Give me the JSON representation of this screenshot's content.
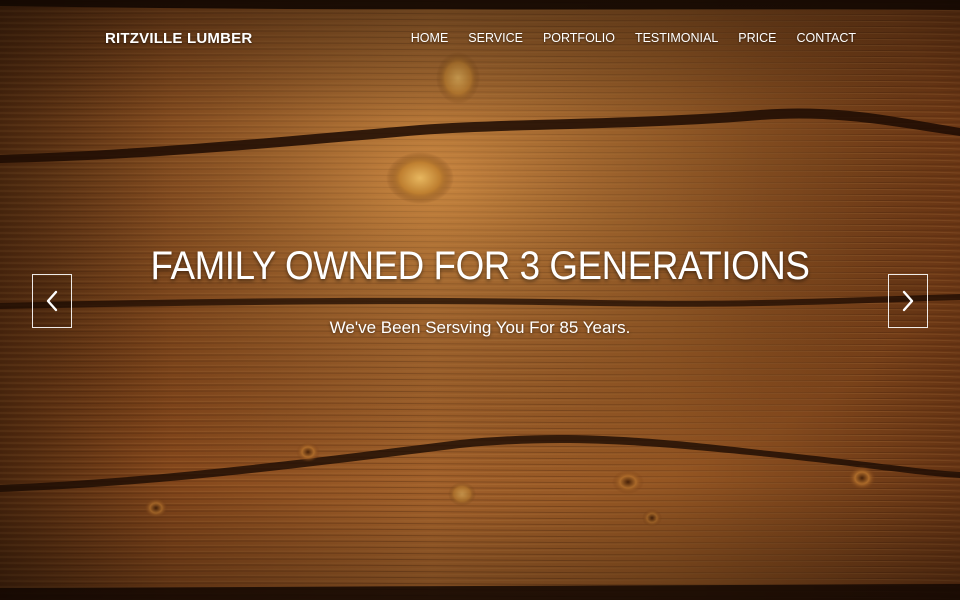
{
  "brand": {
    "name": "RITZVILLE LUMBER"
  },
  "nav": {
    "items": [
      {
        "label": "HOME"
      },
      {
        "label": "SERVICE"
      },
      {
        "label": "PORTFOLIO"
      },
      {
        "label": "TESTIMONIAL"
      },
      {
        "label": "PRICE"
      },
      {
        "label": "CONTACT"
      }
    ]
  },
  "hero": {
    "headline": "FAMILY OWNED FOR 3 GENERATIONS",
    "subheadline": "We've Been Sersving You For 85 Years.",
    "prev_icon": "chevron-left-icon",
    "next_icon": "chevron-right-icon"
  },
  "colors": {
    "text": "#ffffff",
    "wood_light": "#b86a2c",
    "wood_dark": "#3a1d0a"
  }
}
